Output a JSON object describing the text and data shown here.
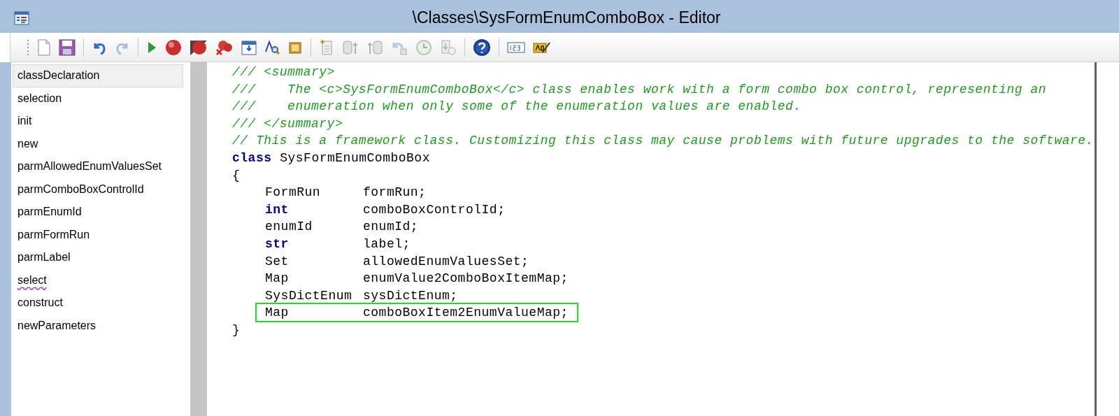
{
  "window": {
    "title": "\\Classes\\SysFormEnumComboBox - Editor"
  },
  "methods": [
    {
      "label": "classDeclaration",
      "selected": true,
      "spelling_error": false
    },
    {
      "label": "selection",
      "selected": false,
      "spelling_error": false
    },
    {
      "label": "init",
      "selected": false,
      "spelling_error": false
    },
    {
      "label": "new",
      "selected": false,
      "spelling_error": false
    },
    {
      "label": "parmAllowedEnumValuesSet",
      "selected": false,
      "spelling_error": false
    },
    {
      "label": "parmComboBoxControlId",
      "selected": false,
      "spelling_error": false
    },
    {
      "label": "parmEnumId",
      "selected": false,
      "spelling_error": false
    },
    {
      "label": "parmFormRun",
      "selected": false,
      "spelling_error": false
    },
    {
      "label": "parmLabel",
      "selected": false,
      "spelling_error": false
    },
    {
      "label": "select",
      "selected": false,
      "spelling_error": true
    },
    {
      "label": "construct",
      "selected": false,
      "spelling_error": false
    },
    {
      "label": "newParameters",
      "selected": false,
      "spelling_error": false
    }
  ],
  "code": [
    {
      "kind": "comment",
      "text": "/// <summary>"
    },
    {
      "kind": "comment",
      "text": "///    The <c>SysFormEnumComboBox</c> class enables work with a form combo box control, representing an"
    },
    {
      "kind": "comment",
      "text": "///    enumeration when only some of the enumeration values are enabled."
    },
    {
      "kind": "comment",
      "text": "/// </summary>"
    },
    {
      "kind": "comment",
      "text": "// This is a framework class. Customizing this class may cause problems with future upgrades to the software."
    },
    {
      "kind": "declaration",
      "keyword": "class",
      "name": "SysFormEnumComboBox"
    },
    {
      "kind": "brace",
      "text": "{"
    },
    {
      "kind": "member",
      "type": "FormRun",
      "type_is_keyword": false,
      "name": "formRun;",
      "highlighted": false
    },
    {
      "kind": "member",
      "type": "int",
      "type_is_keyword": true,
      "name": "comboBoxControlId;",
      "highlighted": false
    },
    {
      "kind": "member",
      "type": "enumId",
      "type_is_keyword": false,
      "name": "enumId;",
      "highlighted": false
    },
    {
      "kind": "member",
      "type": "str",
      "type_is_keyword": true,
      "name": "label;",
      "highlighted": false
    },
    {
      "kind": "member",
      "type": "Set",
      "type_is_keyword": false,
      "name": "allowedEnumValuesSet;",
      "highlighted": false
    },
    {
      "kind": "member",
      "type": "Map",
      "type_is_keyword": false,
      "name": "enumValue2ComboBoxItemMap;",
      "highlighted": false
    },
    {
      "kind": "member",
      "type": "SysDictEnum",
      "type_is_keyword": false,
      "name": "sysDictEnum;",
      "highlighted": false
    },
    {
      "kind": "member",
      "type": "Map",
      "type_is_keyword": false,
      "name": "comboBoxItem2EnumValueMap;",
      "highlighted": true
    },
    {
      "kind": "brace",
      "text": "}"
    }
  ]
}
